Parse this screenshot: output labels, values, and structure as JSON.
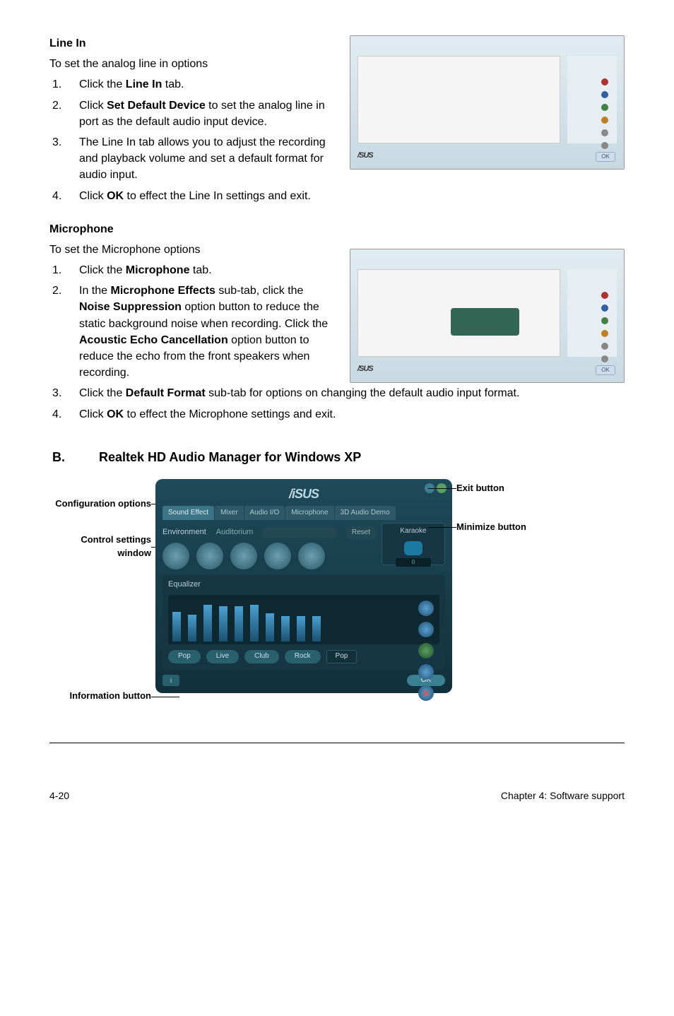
{
  "line_in": {
    "heading": "Line In",
    "intro": "To set the analog line in options",
    "steps": [
      {
        "num": "1.",
        "pre": "Click the ",
        "bold": "Line In",
        "post": " tab."
      },
      {
        "num": "2.",
        "pre": "Click ",
        "bold": "Set Default Device",
        "post": " to set the analog line in port as the default audio input device."
      },
      {
        "num": "3.",
        "plain": "The Line In tab allows you to adjust the recording and playback volume and set a default format for audio input."
      },
      {
        "num": "4.",
        "pre": "Click ",
        "bold": "OK",
        "post": " to effect the Line In settings and exit."
      }
    ]
  },
  "microphone": {
    "heading": "Microphone",
    "intro": "To set the Microphone options",
    "step1": {
      "num": "1.",
      "pre": "Click the ",
      "bold": "Microphone",
      "post": " tab."
    },
    "step2": {
      "num": "2.",
      "p1": "In the ",
      "b1": "Microphone Effects",
      "p2": " sub-tab, click the ",
      "b2": "Noise Suppression",
      "p3": " option button to reduce the static background noise when recording. Click the ",
      "b3": "Acoustic Echo Cancellation",
      "p4": " option button to reduce the echo from the front speakers when recording."
    },
    "step3": {
      "num": "3.",
      "pre": "Click the ",
      "bold": "Default Format",
      "post": " sub-tab for options on changing the default audio input format."
    },
    "step4": {
      "num": "4.",
      "pre": "Click ",
      "bold": "OK",
      "post": " to effect the Microphone settings and exit."
    }
  },
  "section_b": {
    "label": "B.",
    "title": "Realtek HD Audio Manager for Windows XP",
    "callouts_left": {
      "config": "Configuration options",
      "control": "Control settings window",
      "info": "Information button"
    },
    "callouts_right": {
      "exit": "Exit button",
      "minimize": "Minimize button"
    },
    "panel": {
      "logo": "/iSUS",
      "tabs": [
        "Sound Effect",
        "Mixer",
        "Audio I/O",
        "Microphone",
        "3D Audio Demo"
      ],
      "env_label": "Environment",
      "auditorium": "Auditorium",
      "reset": "Reset",
      "karaoke": "Karaoke",
      "karaoke_val": "0",
      "equalizer": "Equalizer",
      "presets": [
        "Pop",
        "Live",
        "Club",
        "Rock"
      ],
      "preset_selected": "Pop",
      "ok": "OK",
      "info_symbol": "i"
    }
  },
  "footer": {
    "left": "4-20",
    "right": "Chapter 4: Software support"
  }
}
